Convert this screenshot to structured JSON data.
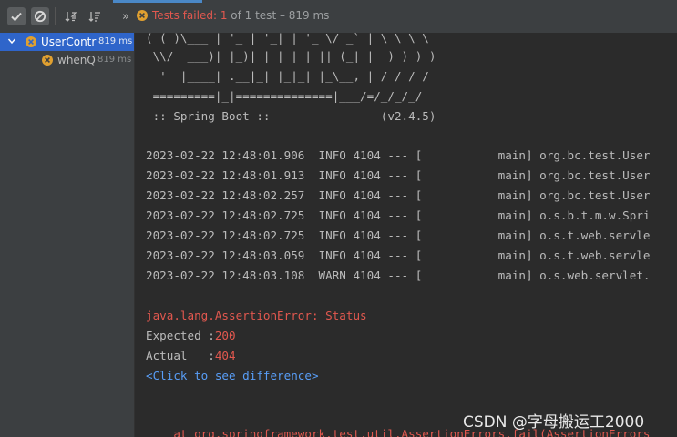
{
  "toolbar": {
    "status_prefix": "Tests failed: ",
    "failed_count": "1",
    "status_suffix": " of 1 test – 819 ms",
    "more_label": "»"
  },
  "tree": {
    "items": [
      {
        "name": "UserContr",
        "time": "819 ms"
      },
      {
        "name": "whenQ",
        "time": "819 ms"
      }
    ]
  },
  "console": {
    "banner": [
      "( ( )\\___ | '_ | '_| | '_ \\/ _` | \\ \\ \\ \\",
      " \\\\/  ___)| |_)| | | | | || (_| |  ) ) ) )",
      "  '  |____| .__|_| |_|_| |_\\__, | / / / /",
      " =========|_|==============|___/=/_/_/_/",
      " :: Spring Boot ::                (v2.4.5)"
    ],
    "logs": [
      "2023-02-22 12:48:01.906  INFO 4104 --- [           main] org.bc.test.User",
      "2023-02-22 12:48:01.913  INFO 4104 --- [           main] org.bc.test.User",
      "2023-02-22 12:48:02.257  INFO 4104 --- [           main] org.bc.test.User",
      "2023-02-22 12:48:02.725  INFO 4104 --- [           main] o.s.b.t.m.w.Spri",
      "2023-02-22 12:48:02.725  INFO 4104 --- [           main] o.s.t.web.servle",
      "2023-02-22 12:48:03.059  INFO 4104 --- [           main] o.s.t.web.servle",
      "2023-02-22 12:48:03.108  WARN 4104 --- [           main] o.s.web.servlet."
    ],
    "error_line": "java.lang.AssertionError: Status",
    "expected_label": "Expected :",
    "expected_value": "200",
    "actual_label": "Actual   :",
    "actual_value": "404",
    "diff_link": "<Click to see difference>",
    "stack_line": "    at org.springframework.test.util.AssertionErrors.fail(AssertionErrors"
  },
  "watermark": "CSDN @字母搬运工2000"
}
